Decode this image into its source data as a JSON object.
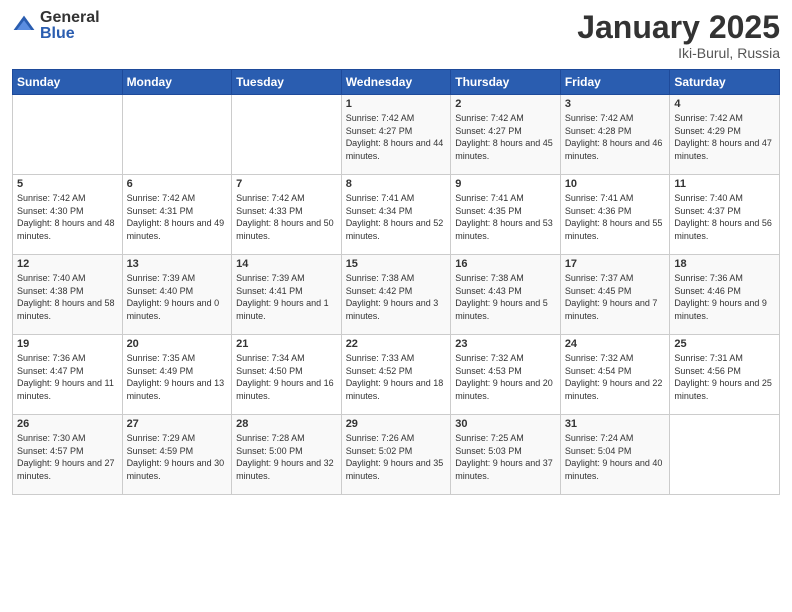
{
  "header": {
    "logo_general": "General",
    "logo_blue": "Blue",
    "month_title": "January 2025",
    "location": "Iki-Burul, Russia"
  },
  "weekdays": [
    "Sunday",
    "Monday",
    "Tuesday",
    "Wednesday",
    "Thursday",
    "Friday",
    "Saturday"
  ],
  "weeks": [
    [
      {
        "day": "",
        "sunrise": "",
        "sunset": "",
        "daylight": ""
      },
      {
        "day": "",
        "sunrise": "",
        "sunset": "",
        "daylight": ""
      },
      {
        "day": "",
        "sunrise": "",
        "sunset": "",
        "daylight": ""
      },
      {
        "day": "1",
        "sunrise": "Sunrise: 7:42 AM",
        "sunset": "Sunset: 4:27 PM",
        "daylight": "Daylight: 8 hours and 44 minutes."
      },
      {
        "day": "2",
        "sunrise": "Sunrise: 7:42 AM",
        "sunset": "Sunset: 4:27 PM",
        "daylight": "Daylight: 8 hours and 45 minutes."
      },
      {
        "day": "3",
        "sunrise": "Sunrise: 7:42 AM",
        "sunset": "Sunset: 4:28 PM",
        "daylight": "Daylight: 8 hours and 46 minutes."
      },
      {
        "day": "4",
        "sunrise": "Sunrise: 7:42 AM",
        "sunset": "Sunset: 4:29 PM",
        "daylight": "Daylight: 8 hours and 47 minutes."
      }
    ],
    [
      {
        "day": "5",
        "sunrise": "Sunrise: 7:42 AM",
        "sunset": "Sunset: 4:30 PM",
        "daylight": "Daylight: 8 hours and 48 minutes."
      },
      {
        "day": "6",
        "sunrise": "Sunrise: 7:42 AM",
        "sunset": "Sunset: 4:31 PM",
        "daylight": "Daylight: 8 hours and 49 minutes."
      },
      {
        "day": "7",
        "sunrise": "Sunrise: 7:42 AM",
        "sunset": "Sunset: 4:33 PM",
        "daylight": "Daylight: 8 hours and 50 minutes."
      },
      {
        "day": "8",
        "sunrise": "Sunrise: 7:41 AM",
        "sunset": "Sunset: 4:34 PM",
        "daylight": "Daylight: 8 hours and 52 minutes."
      },
      {
        "day": "9",
        "sunrise": "Sunrise: 7:41 AM",
        "sunset": "Sunset: 4:35 PM",
        "daylight": "Daylight: 8 hours and 53 minutes."
      },
      {
        "day": "10",
        "sunrise": "Sunrise: 7:41 AM",
        "sunset": "Sunset: 4:36 PM",
        "daylight": "Daylight: 8 hours and 55 minutes."
      },
      {
        "day": "11",
        "sunrise": "Sunrise: 7:40 AM",
        "sunset": "Sunset: 4:37 PM",
        "daylight": "Daylight: 8 hours and 56 minutes."
      }
    ],
    [
      {
        "day": "12",
        "sunrise": "Sunrise: 7:40 AM",
        "sunset": "Sunset: 4:38 PM",
        "daylight": "Daylight: 8 hours and 58 minutes."
      },
      {
        "day": "13",
        "sunrise": "Sunrise: 7:39 AM",
        "sunset": "Sunset: 4:40 PM",
        "daylight": "Daylight: 9 hours and 0 minutes."
      },
      {
        "day": "14",
        "sunrise": "Sunrise: 7:39 AM",
        "sunset": "Sunset: 4:41 PM",
        "daylight": "Daylight: 9 hours and 1 minute."
      },
      {
        "day": "15",
        "sunrise": "Sunrise: 7:38 AM",
        "sunset": "Sunset: 4:42 PM",
        "daylight": "Daylight: 9 hours and 3 minutes."
      },
      {
        "day": "16",
        "sunrise": "Sunrise: 7:38 AM",
        "sunset": "Sunset: 4:43 PM",
        "daylight": "Daylight: 9 hours and 5 minutes."
      },
      {
        "day": "17",
        "sunrise": "Sunrise: 7:37 AM",
        "sunset": "Sunset: 4:45 PM",
        "daylight": "Daylight: 9 hours and 7 minutes."
      },
      {
        "day": "18",
        "sunrise": "Sunrise: 7:36 AM",
        "sunset": "Sunset: 4:46 PM",
        "daylight": "Daylight: 9 hours and 9 minutes."
      }
    ],
    [
      {
        "day": "19",
        "sunrise": "Sunrise: 7:36 AM",
        "sunset": "Sunset: 4:47 PM",
        "daylight": "Daylight: 9 hours and 11 minutes."
      },
      {
        "day": "20",
        "sunrise": "Sunrise: 7:35 AM",
        "sunset": "Sunset: 4:49 PM",
        "daylight": "Daylight: 9 hours and 13 minutes."
      },
      {
        "day": "21",
        "sunrise": "Sunrise: 7:34 AM",
        "sunset": "Sunset: 4:50 PM",
        "daylight": "Daylight: 9 hours and 16 minutes."
      },
      {
        "day": "22",
        "sunrise": "Sunrise: 7:33 AM",
        "sunset": "Sunset: 4:52 PM",
        "daylight": "Daylight: 9 hours and 18 minutes."
      },
      {
        "day": "23",
        "sunrise": "Sunrise: 7:32 AM",
        "sunset": "Sunset: 4:53 PM",
        "daylight": "Daylight: 9 hours and 20 minutes."
      },
      {
        "day": "24",
        "sunrise": "Sunrise: 7:32 AM",
        "sunset": "Sunset: 4:54 PM",
        "daylight": "Daylight: 9 hours and 22 minutes."
      },
      {
        "day": "25",
        "sunrise": "Sunrise: 7:31 AM",
        "sunset": "Sunset: 4:56 PM",
        "daylight": "Daylight: 9 hours and 25 minutes."
      }
    ],
    [
      {
        "day": "26",
        "sunrise": "Sunrise: 7:30 AM",
        "sunset": "Sunset: 4:57 PM",
        "daylight": "Daylight: 9 hours and 27 minutes."
      },
      {
        "day": "27",
        "sunrise": "Sunrise: 7:29 AM",
        "sunset": "Sunset: 4:59 PM",
        "daylight": "Daylight: 9 hours and 30 minutes."
      },
      {
        "day": "28",
        "sunrise": "Sunrise: 7:28 AM",
        "sunset": "Sunset: 5:00 PM",
        "daylight": "Daylight: 9 hours and 32 minutes."
      },
      {
        "day": "29",
        "sunrise": "Sunrise: 7:26 AM",
        "sunset": "Sunset: 5:02 PM",
        "daylight": "Daylight: 9 hours and 35 minutes."
      },
      {
        "day": "30",
        "sunrise": "Sunrise: 7:25 AM",
        "sunset": "Sunset: 5:03 PM",
        "daylight": "Daylight: 9 hours and 37 minutes."
      },
      {
        "day": "31",
        "sunrise": "Sunrise: 7:24 AM",
        "sunset": "Sunset: 5:04 PM",
        "daylight": "Daylight: 9 hours and 40 minutes."
      },
      {
        "day": "",
        "sunrise": "",
        "sunset": "",
        "daylight": ""
      }
    ]
  ]
}
